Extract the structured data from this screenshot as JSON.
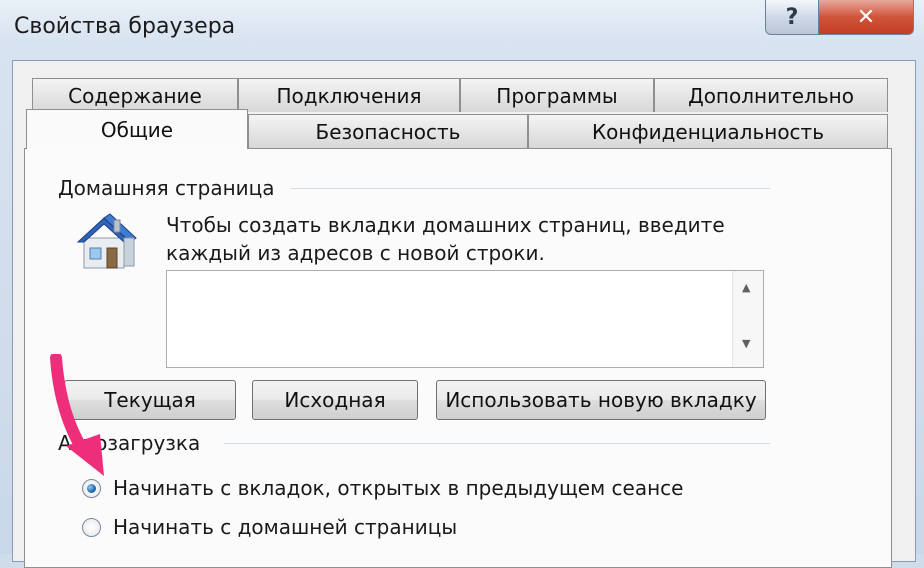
{
  "window": {
    "title": "Свойства браузера",
    "help_glyph": "?",
    "close_glyph": "✕"
  },
  "tabs_row1": [
    "Содержание",
    "Подключения",
    "Программы",
    "Дополнительно"
  ],
  "tabs_row2": [
    "Общие",
    "Безопасность",
    "Конфиденциальность"
  ],
  "active_tab": "Общие",
  "home_page": {
    "group_label": "Домашняя страница",
    "description": "Чтобы создать вкладки домашних страниц, введите каждый из адресов с новой строки.",
    "textarea_value": "",
    "buttons": {
      "current": "Текущая",
      "default": "Исходная",
      "new_tab": "Использовать новую вкладку"
    }
  },
  "startup": {
    "group_label": "Автозагрузка",
    "options": [
      {
        "label": "Начинать с вкладок, открытых в предыдущем сеансе",
        "checked": true
      },
      {
        "label": "Начинать с домашней страницы",
        "checked": false
      }
    ]
  },
  "colors": {
    "annotation_arrow": "#ee2e7b",
    "radio_selected": "#2a6fb5"
  },
  "icons": {
    "home": "house-icon",
    "help": "question-icon",
    "close": "close-icon"
  }
}
